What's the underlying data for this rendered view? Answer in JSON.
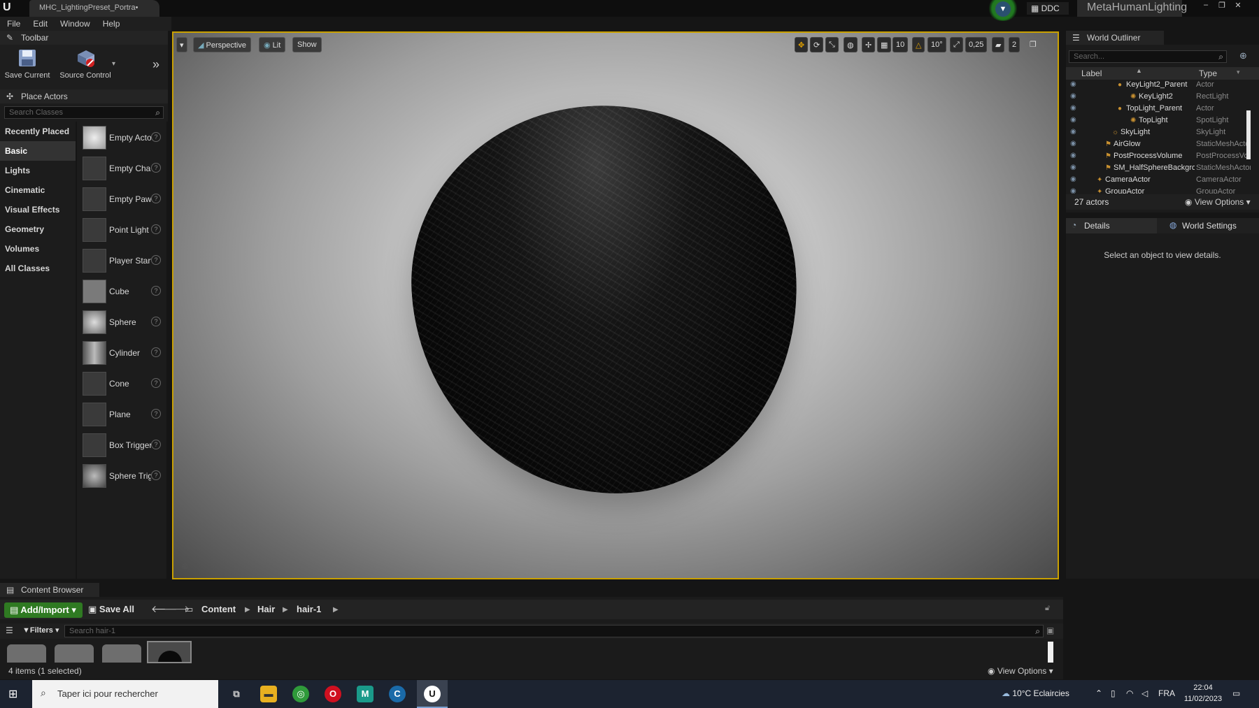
{
  "window": {
    "tab_title": "MHC_LightingPreset_Portra•",
    "project_name": "MetaHumanLighting",
    "ddc_label": "DDC",
    "controls": [
      "–",
      "❐",
      "✕"
    ]
  },
  "menu": [
    "File",
    "Edit",
    "Window",
    "Help"
  ],
  "toolbar": {
    "panel_title": "Toolbar",
    "save_current": "Save Current",
    "source_control": "Source Control"
  },
  "place_actors": {
    "panel_title": "Place Actors",
    "search_placeholder": "Search Classes",
    "categories": [
      "Recently Placed",
      "Basic",
      "Lights",
      "Cinematic",
      "Visual Effects",
      "Geometry",
      "Volumes",
      "All Classes"
    ],
    "active_category": "Basic",
    "items": [
      "Empty Actor",
      "Empty Character",
      "Empty Pawn",
      "Point Light",
      "Player Start",
      "Cube",
      "Sphere",
      "Cylinder",
      "Cone",
      "Plane",
      "Box Trigger",
      "Sphere Trigger"
    ]
  },
  "viewport": {
    "perspective": "Perspective",
    "lit": "Lit",
    "show": "Show",
    "grid_snap": "10",
    "rotation_snap": "10°",
    "scale_snap": "0,25",
    "camera_speed": "2"
  },
  "outliner": {
    "panel_title": "World Outliner",
    "search_placeholder": "Search...",
    "col_label": "Label",
    "col_type": "Type",
    "rows": [
      {
        "label": "KeyLight2_Parent",
        "type": "Actor"
      },
      {
        "label": "KeyLight2",
        "type": "RectLight"
      },
      {
        "label": "TopLight_Parent",
        "type": "Actor"
      },
      {
        "label": "TopLight",
        "type": "SpotLight"
      },
      {
        "label": "SkyLight",
        "type": "SkyLight"
      },
      {
        "label": "AirGlow",
        "type": "StaticMeshActor"
      },
      {
        "label": "PostProcessVolume",
        "type": "PostProcessVolume"
      },
      {
        "label": "SM_HalfSphereBackground",
        "type": "StaticMeshActor"
      },
      {
        "label": "CameraActor",
        "type": "CameraActor"
      },
      {
        "label": "GroupActor",
        "type": "GroupActor"
      }
    ],
    "actor_count": "27 actors",
    "view_options": "View Options"
  },
  "details": {
    "tab_details": "Details",
    "tab_world_settings": "World Settings",
    "empty_message": "Select an object to view details."
  },
  "content_browser": {
    "panel_title": "Content Browser",
    "add_import": "Add/Import",
    "save_all": "Save All",
    "path": [
      "Content",
      "Hair",
      "hair-1"
    ],
    "filters": "Filters",
    "search_placeholder": "Search hair-1",
    "status": "4 items (1 selected)",
    "view_options": "View Options"
  },
  "taskbar": {
    "search_placeholder": "Taper ici pour rechercher",
    "weather": "10°C  Eclaircies",
    "lang": "FRA",
    "time": "22:04",
    "date": "11/02/2023"
  }
}
